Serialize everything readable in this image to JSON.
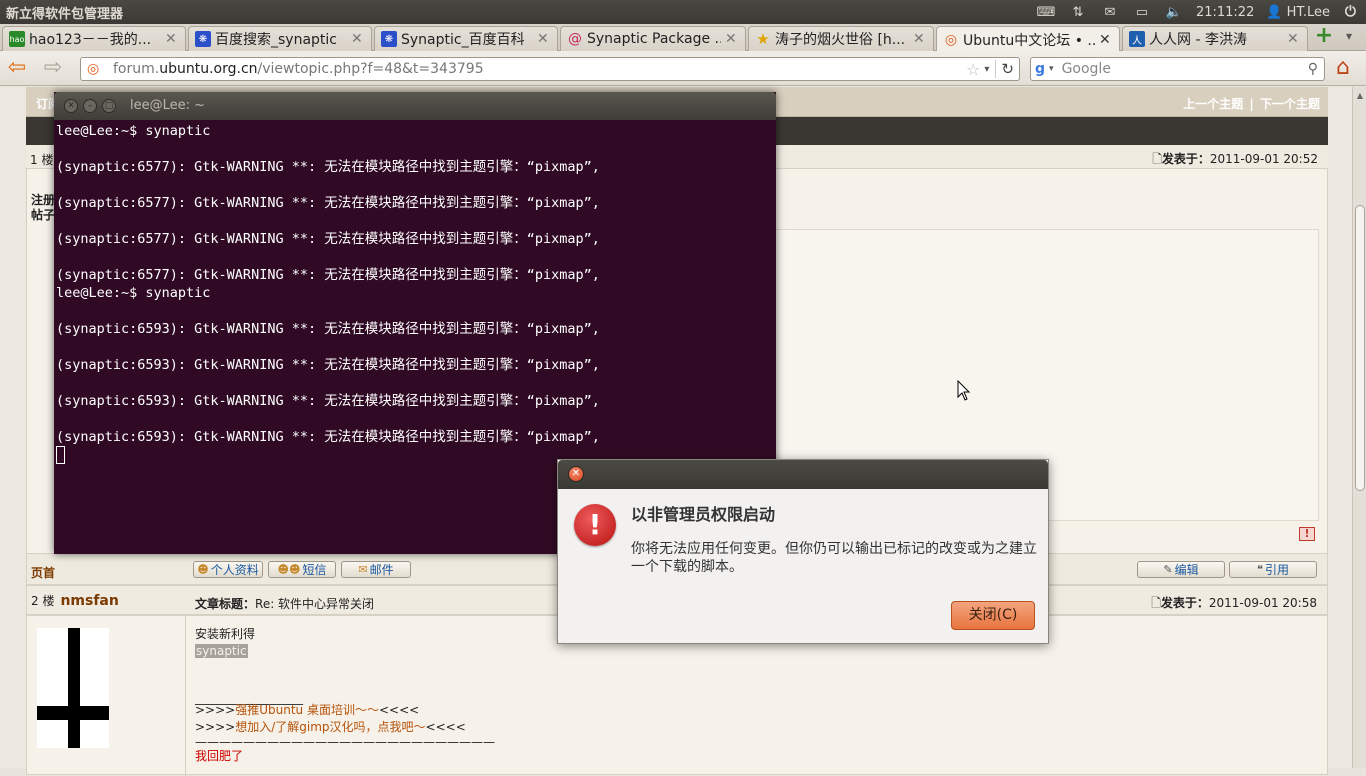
{
  "panel": {
    "app_title": "新立得软件包管理器",
    "time": "21:11:22",
    "user": "HT.Lee"
  },
  "tabs": [
    {
      "label": "hao123－－我的...",
      "color": "#2a8a2a",
      "glyph": "hao"
    },
    {
      "label": "百度搜索_synaptic",
      "color": "#2b4fc9",
      "glyph": "❋"
    },
    {
      "label": "Synaptic_百度百科",
      "color": "#2b4fc9",
      "glyph": "❋"
    },
    {
      "label": "Synaptic Package ...",
      "color": "#c1275a",
      "glyph": "@"
    },
    {
      "label": "涛子的烟火世俗 [h...",
      "color": "#e0a400",
      "glyph": "★"
    },
    {
      "label": "Ubuntu中文论坛 • ...",
      "color": "#e05a1a",
      "glyph": "◎"
    },
    {
      "label": "人人网 - 李洪涛",
      "color": "#1f5fb0",
      "glyph": "人"
    }
  ],
  "nav": {
    "url_prefix": "forum.",
    "url_domain": "ubuntu.org.cn",
    "url_path": "/viewtopic.php?f=48&t=343795",
    "search_placeholder": "Google"
  },
  "forum": {
    "top_left": "订阅",
    "prev_topic": "上一个主题",
    "sep": "|",
    "next_topic": "下一个主题",
    "post1": {
      "floor": "1 楼",
      "time_label": "发表于：",
      "time": "2011-09-01 20:52",
      "side_line1": "注册",
      "side_line2": "帖子"
    },
    "footer": {
      "top_link": "页首",
      "profile": "个人资料",
      "message": "短信",
      "email": "邮件",
      "edit": "编辑",
      "quote": "引用"
    },
    "post2": {
      "floor": "2 楼",
      "author": "nmsfan",
      "title_label": "文章标题：",
      "title": "Re: 软件中心异常关闭",
      "time_label": "发表于：",
      "time": "2011-09-01 20:58",
      "line1": "安装新利得",
      "line2": "synaptic",
      "divider": "__________________",
      "sig1_prefix": ">>>>",
      "sig1_link": "强推Ubuntu 桌面培训～～",
      "sig1_suffix": "<<<<",
      "sig2_prefix": ">>>>",
      "sig2_link": "想加入/了解gimp汉化吗，点我吧～",
      "sig2_suffix": "<<<<",
      "dash_line": "—————————————————————————",
      "red_line": "我回肥了"
    }
  },
  "terminal": {
    "title": "lee@Lee: ~",
    "output": "lee@Lee:~$ synaptic\n\n(synaptic:6577): Gtk-WARNING **: 无法在模块路径中找到主题引擎：“pixmap”,\n\n(synaptic:6577): Gtk-WARNING **: 无法在模块路径中找到主题引擎：“pixmap”,\n\n(synaptic:6577): Gtk-WARNING **: 无法在模块路径中找到主题引擎：“pixmap”,\n\n(synaptic:6577): Gtk-WARNING **: 无法在模块路径中找到主题引擎：“pixmap”,\nlee@Lee:~$ synaptic\n\n(synaptic:6593): Gtk-WARNING **: 无法在模块路径中找到主题引擎：“pixmap”,\n\n(synaptic:6593): Gtk-WARNING **: 无法在模块路径中找到主题引擎：“pixmap”,\n\n(synaptic:6593): Gtk-WARNING **: 无法在模块路径中找到主题引擎：“pixmap”,\n\n(synaptic:6593): Gtk-WARNING **: 无法在模块路径中找到主题引擎：“pixmap”,"
  },
  "dialog": {
    "title": "以非管理员权限启动",
    "message": "你将无法应用任何变更。但你仍可以输出已标记的改变或为之建立一个下载的脚本。",
    "close_button": "关闭(C)"
  }
}
